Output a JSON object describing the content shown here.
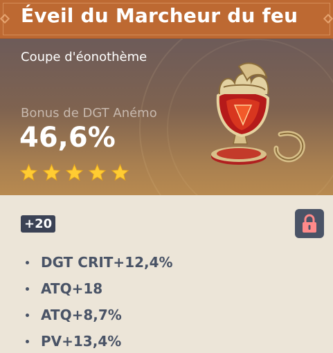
{
  "artifact": {
    "name": "Éveil du Marcheur du feu",
    "slot_type": "Coupe d'éonothème",
    "main_stat": {
      "label": "Bonus de DGT Anémo",
      "value": "46,6%"
    },
    "rarity": 5,
    "level": "+20",
    "locked": true,
    "substats": [
      {
        "text": "DGT CRIT+12,4%"
      },
      {
        "text": "ATQ+18"
      },
      {
        "text": "ATQ+8,7%"
      },
      {
        "text": "PV+13,4%"
      }
    ]
  },
  "colors": {
    "title_bar": "#bd6932",
    "star": "#ffcc32",
    "lock_icon": "#ff8a8a",
    "badge": "#3b4255",
    "substat_text": "#495366",
    "detail_bg": "#ece5d8"
  },
  "icons": {
    "star": "star-icon",
    "lock": "lock-icon",
    "artifact": "goblet-artifact-icon"
  }
}
